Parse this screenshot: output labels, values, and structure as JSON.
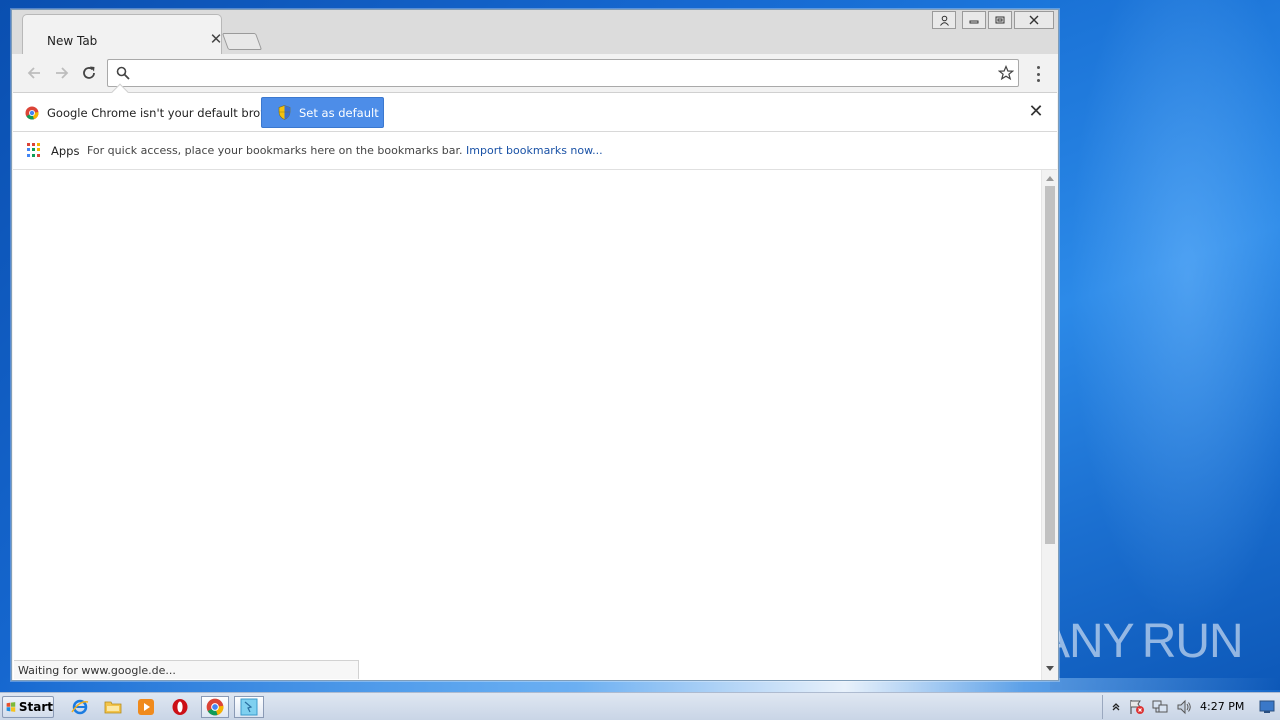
{
  "browser": {
    "tab": {
      "title": "New Tab",
      "close_glyph": "✕"
    },
    "omnibox": {
      "value": "",
      "placeholder": ""
    },
    "infobar": {
      "message": "Google Chrome isn't your default browser.",
      "button_label": "Set as default",
      "close_glyph": "✕"
    },
    "bookmarks_bar": {
      "apps_label": "Apps",
      "hint": "For quick access, place your bookmarks here on the bookmarks bar.",
      "import_link": "Import bookmarks now..."
    },
    "status": "Waiting for www.google.de..."
  },
  "window_controls": [
    "user-icon",
    "minimize-icon",
    "restore-icon",
    "close-icon"
  ],
  "taskbar": {
    "start_label": "Start",
    "pinned": [
      "internet-explorer-icon",
      "explorer-folder-icon",
      "media-player-icon",
      "opera-icon",
      "chrome-icon",
      "app-icon"
    ],
    "clock": "4:27 PM"
  },
  "watermark": {
    "text": "ANY RUN"
  },
  "colors": {
    "accent": "#4d8de8",
    "link": "#1a52a6",
    "desktop": "#1668d0"
  }
}
